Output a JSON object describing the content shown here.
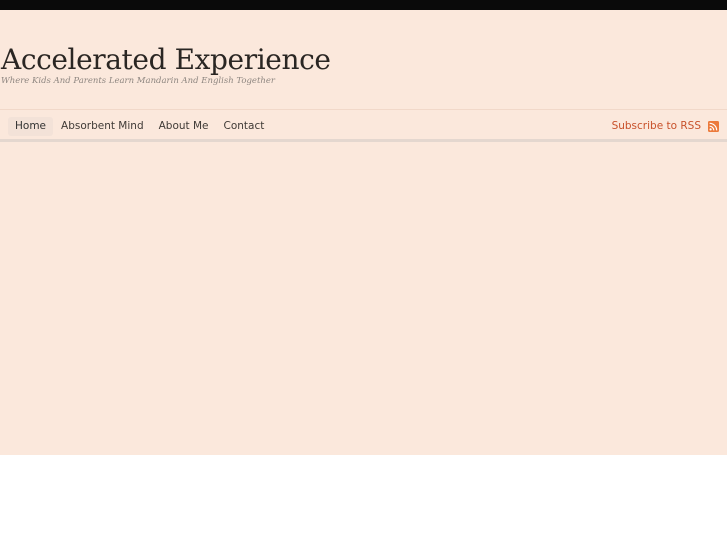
{
  "site": {
    "title": "Accelerated Experience",
    "description": "Where Kids And Parents Learn Mandarin And English Together"
  },
  "nav": {
    "items": [
      {
        "label": "Home",
        "active": true
      },
      {
        "label": "Absorbent Mind",
        "active": false
      },
      {
        "label": "About Me",
        "active": false
      },
      {
        "label": "Contact",
        "active": false
      }
    ],
    "subscribe_label": "Subscribe to RSS"
  },
  "icons": {
    "rss": "rss-icon"
  },
  "colors": {
    "page_background": "#fbe8dc",
    "top_bar": "#0a0a0a",
    "link_accent": "#c8512a",
    "rss_icon": "#ec7a3b"
  }
}
